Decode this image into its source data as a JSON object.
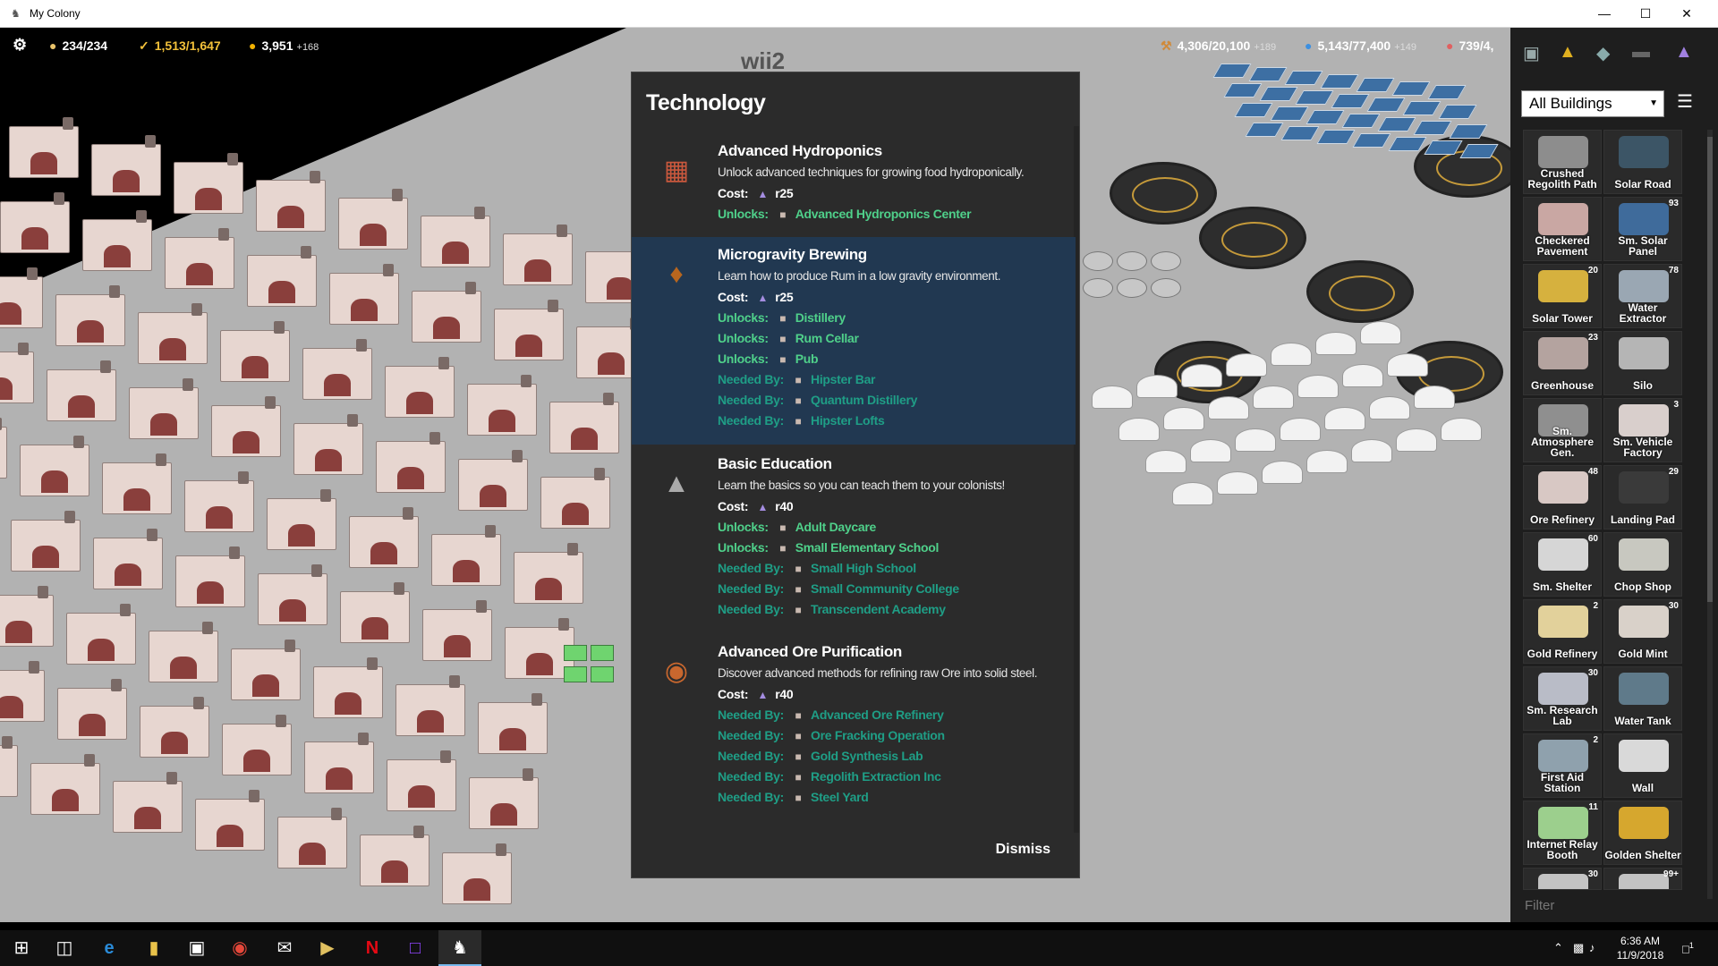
{
  "window": {
    "title": "My Colony",
    "minimize_icon": "minimize-icon",
    "maximize_icon": "maximize-icon",
    "close_icon": "close-icon"
  },
  "hud": {
    "settings_icon": "gear-icon",
    "population": "234/234",
    "energy": "1,513/1,647",
    "money": "3,951",
    "money_delta": "+168",
    "ore": "4,306/20,100",
    "ore_delta": "+189",
    "water": "5,143/77,400",
    "water_delta": "+149",
    "food": "739/4,",
    "map_label": "wii2"
  },
  "modal": {
    "heading": "Technology",
    "dismiss_label": "Dismiss",
    "technologies": [
      {
        "name": "Advanced Hydroponics",
        "description": "Unlock advanced techniques for growing food hydroponically.",
        "cost_label": "Cost:",
        "cost": "r25",
        "icon": "hydroponics-icon",
        "rows": [
          {
            "kind": "unlock",
            "label": "Unlocks:",
            "item": "Advanced Hydroponics Center"
          }
        ]
      },
      {
        "name": "Microgravity Brewing",
        "description": "Learn how to produce Rum in a low gravity environment.",
        "cost_label": "Cost:",
        "cost": "r25",
        "icon": "rum-bottle-icon",
        "rows": [
          {
            "kind": "unlock",
            "label": "Unlocks:",
            "item": "Distillery"
          },
          {
            "kind": "unlock",
            "label": "Unlocks:",
            "item": "Rum Cellar"
          },
          {
            "kind": "unlock",
            "label": "Unlocks:",
            "item": "Pub"
          },
          {
            "kind": "needed",
            "label": "Needed By:",
            "item": "Hipster Bar"
          },
          {
            "kind": "needed",
            "label": "Needed By:",
            "item": "Quantum Distillery"
          },
          {
            "kind": "needed",
            "label": "Needed By:",
            "item": "Hipster Lofts"
          }
        ]
      },
      {
        "name": "Basic Education",
        "description": "Learn the basics so you can teach them to your colonists!",
        "cost_label": "Cost:",
        "cost": "r40",
        "icon": "graduation-cap-icon",
        "rows": [
          {
            "kind": "unlock",
            "label": "Unlocks:",
            "item": "Adult Daycare"
          },
          {
            "kind": "unlock",
            "label": "Unlocks:",
            "item": "Small Elementary School"
          },
          {
            "kind": "needed",
            "label": "Needed By:",
            "item": "Small High School"
          },
          {
            "kind": "needed",
            "label": "Needed By:",
            "item": "Small Community College"
          },
          {
            "kind": "needed",
            "label": "Needed By:",
            "item": "Transcendent Academy"
          }
        ]
      },
      {
        "name": "Advanced Ore Purification",
        "description": "Discover advanced methods for refining raw Ore into solid steel.",
        "cost_label": "Cost:",
        "cost": "r40",
        "icon": "ore-icon",
        "rows": [
          {
            "kind": "needed",
            "label": "Needed By:",
            "item": "Advanced Ore Refinery"
          },
          {
            "kind": "needed",
            "label": "Needed By:",
            "item": "Ore Fracking Operation"
          },
          {
            "kind": "needed",
            "label": "Needed By:",
            "item": "Gold Synthesis Lab"
          },
          {
            "kind": "needed",
            "label": "Needed By:",
            "item": "Regolith Extraction Inc"
          },
          {
            "kind": "needed",
            "label": "Needed By:",
            "item": "Steel Yard"
          }
        ]
      }
    ]
  },
  "panel": {
    "category": "All Buildings",
    "filter_placeholder": "Filter",
    "buildings": [
      {
        "name": "Crushed Regolith Path",
        "count": "",
        "color": "#8d8d8d"
      },
      {
        "name": "Solar Road",
        "count": "",
        "color": "#3c5566"
      },
      {
        "name": "Checkered Pavement",
        "count": "",
        "color": "#c9a7a3"
      },
      {
        "name": "Sm. Solar Panel",
        "count": "93",
        "color": "#3f6b9b"
      },
      {
        "name": "Solar Tower",
        "count": "20",
        "color": "#d6b13e"
      },
      {
        "name": "Water Extractor",
        "count": "78",
        "color": "#9aa7b3"
      },
      {
        "name": "Greenhouse",
        "count": "23",
        "color": "#b4a39f"
      },
      {
        "name": "Silo",
        "count": "",
        "color": "#b5b5b5"
      },
      {
        "name": "Sm. Atmosphere Gen.",
        "count": "",
        "color": "#8f8f8f"
      },
      {
        "name": "Sm. Vehicle Factory",
        "count": "3",
        "color": "#d9cfcc"
      },
      {
        "name": "Ore Refinery",
        "count": "48",
        "color": "#d8c8c4"
      },
      {
        "name": "Landing Pad",
        "count": "29",
        "color": "#3a3a3a"
      },
      {
        "name": "Sm. Shelter",
        "count": "60",
        "color": "#d6d6d6"
      },
      {
        "name": "Chop Shop",
        "count": "",
        "color": "#c8c8c0"
      },
      {
        "name": "Gold Refinery",
        "count": "2",
        "color": "#e2d19b"
      },
      {
        "name": "Gold Mint",
        "count": "30",
        "color": "#d9d1c9"
      },
      {
        "name": "Sm. Research Lab",
        "count": "30",
        "color": "#b9bcc7"
      },
      {
        "name": "Water Tank",
        "count": "",
        "color": "#5f7a8a"
      },
      {
        "name": "First Aid Station",
        "count": "2",
        "color": "#8fa1ad"
      },
      {
        "name": "Wall",
        "count": "",
        "color": "#d9d9d9"
      },
      {
        "name": "Internet Relay Booth",
        "count": "11",
        "color": "#9ccf8d"
      },
      {
        "name": "Golden Shelter",
        "count": "",
        "color": "#d6a72e"
      },
      {
        "name": "",
        "count": "30",
        "color": "#c3c3c3"
      },
      {
        "name": "",
        "count": "99+",
        "color": "#c3c3c3"
      }
    ]
  },
  "taskbar": {
    "time": "6:36 AM",
    "date": "11/9/2018",
    "notification_count": "1"
  }
}
